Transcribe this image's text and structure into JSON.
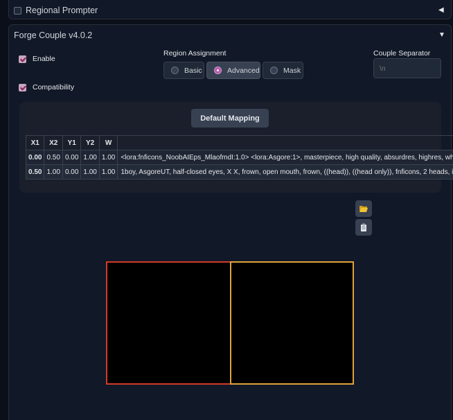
{
  "regional_prompter": {
    "title": "Regional Prompter",
    "collapsed": true,
    "caret": "◀"
  },
  "forge_couple": {
    "title": "Forge Couple v4.0.2",
    "caret": "▼",
    "enable_label": "Enable",
    "enable_checked": true,
    "compat_label": "Compatibility",
    "compat_checked": true,
    "region_assignment": {
      "label": "Region Assignment",
      "options": [
        "Basic",
        "Advanced",
        "Mask"
      ],
      "selected": "Advanced"
    },
    "separator": {
      "label": "Couple Separator",
      "placeholder": "\\n"
    },
    "default_mapping_label": "Default Mapping",
    "table": {
      "headers": [
        "X1",
        "X2",
        "Y1",
        "Y2",
        "W"
      ],
      "rows": [
        {
          "x1": "0.00",
          "x2": "0.50",
          "y1": "0.00",
          "y2": "1.00",
          "w": "1.00",
          "prompt": "<lora:fnficons_NoobAIEps_MlaofmdI:1.0> <lora:Asgore:1>, masterpiece, high quality, absurdres, highres, wh"
        },
        {
          "x1": "0.50",
          "x2": "1.00",
          "y1": "0.00",
          "y2": "1.00",
          "w": "1.00",
          "prompt": "1boy, AsgoreUT, half-closed eyes, X X, frown, open mouth, frown, ((head)), ((head only)), fnficons, 2 heads, ic"
        }
      ]
    },
    "icons": {
      "load": "folder-open-icon",
      "clear": "clipboard-icon"
    },
    "regions": [
      {
        "color": "#d13b2a"
      },
      {
        "color": "#e0a23b"
      }
    ]
  }
}
